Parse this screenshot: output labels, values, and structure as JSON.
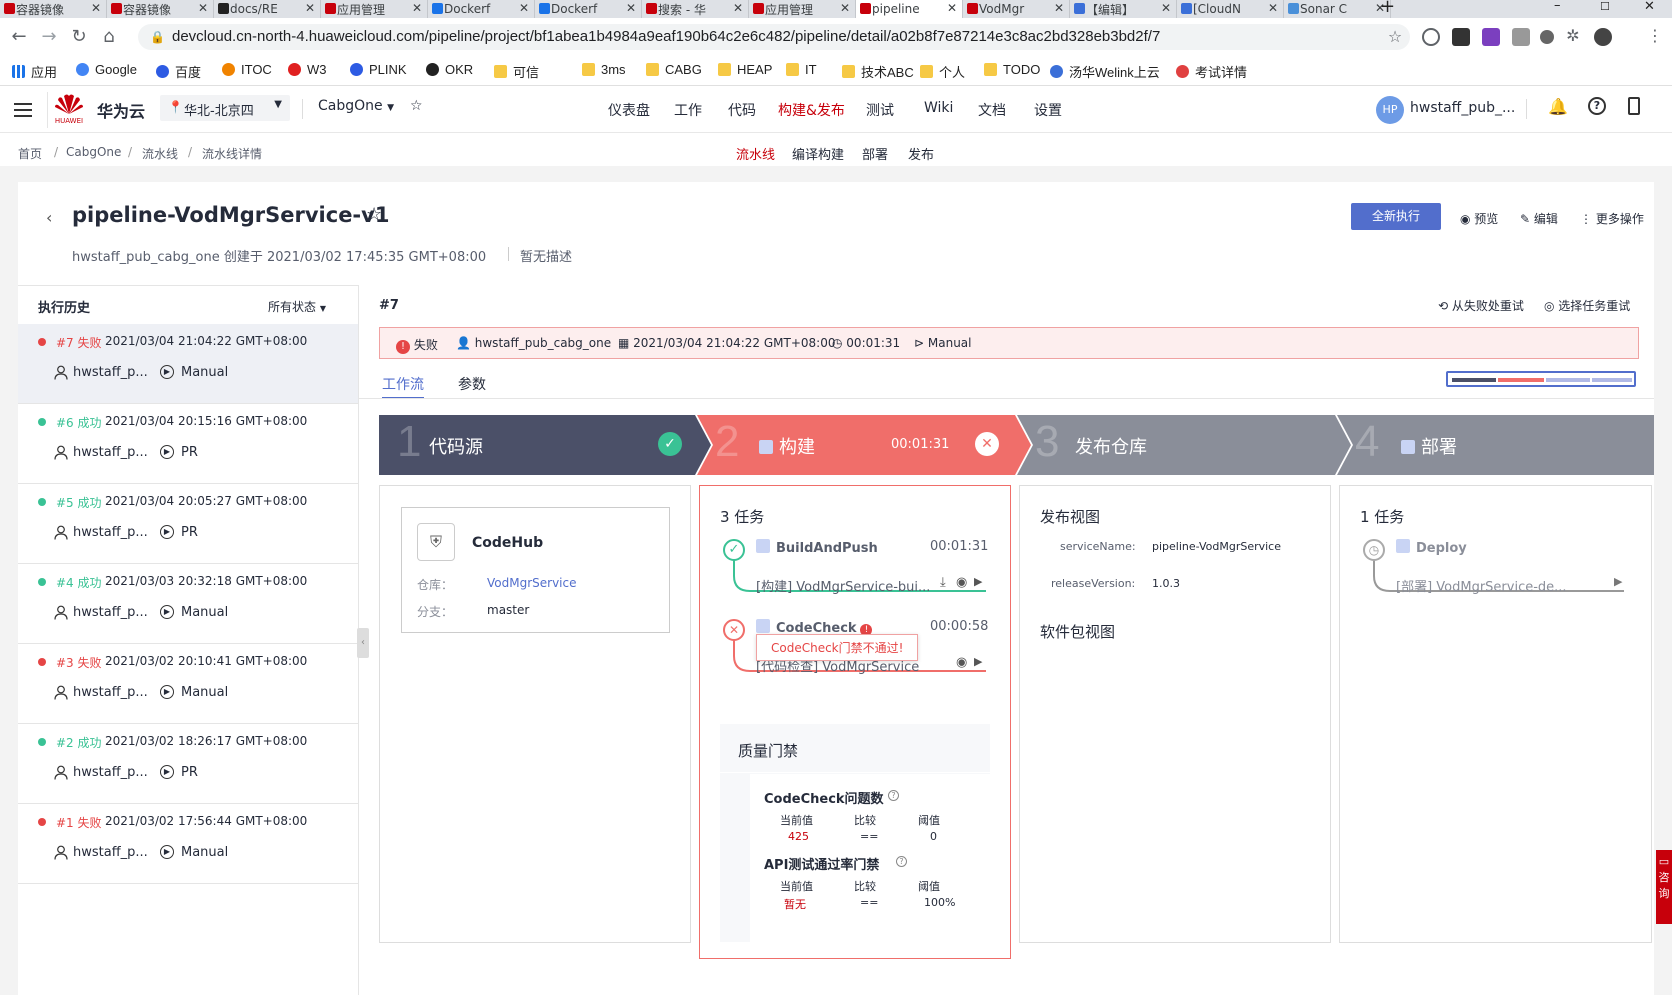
{
  "browser": {
    "tabs": [
      {
        "label": "容器镜像",
        "color": "#c7000b"
      },
      {
        "label": "容器镜像",
        "color": "#c7000b"
      },
      {
        "label": "docs/RE",
        "color": "#222222"
      },
      {
        "label": "应用管理",
        "color": "#c7000b"
      },
      {
        "label": "Dockerf",
        "color": "#1a73e8"
      },
      {
        "label": "Dockerf",
        "color": "#1a73e8"
      },
      {
        "label": "搜索 - 华",
        "color": "#c7000b"
      },
      {
        "label": "应用管理",
        "color": "#c7000b"
      },
      {
        "label": "pipeline",
        "color": "#c7000b"
      },
      {
        "label": "VodMgr",
        "color": "#c7000b"
      },
      {
        "label": "【编辑】",
        "color": "#3b6fd8"
      },
      {
        "label": "[CloudN",
        "color": "#3b6fd8"
      },
      {
        "label": "Sonar C",
        "color": "#4a90d9"
      }
    ],
    "new_tab": "+",
    "win_min": "–",
    "win_max": "☐",
    "url": "devcloud.cn-north-4.huaweicloud.com/pipeline/project/bf1abea1b4984a9eaf190b64c2e6c482/pipeline/detail/a02b8f7e87214e3c8ac2bd328eb3bd2f/7",
    "bookmarks": [
      "应用",
      "Google",
      "百度",
      "ITOC",
      "W3",
      "PLINK",
      "OKR",
      "可信",
      "3ms",
      "CABG",
      "HEAP",
      "IT",
      "技术ABC",
      "个人",
      "TODO",
      "汤华Welink上云",
      "考试详情"
    ]
  },
  "app": {
    "brand": "华为云",
    "logo_text": "HUAWEI",
    "region": "华北-北京四",
    "project": "CabgOne",
    "nav": [
      "仪表盘",
      "工作",
      "代码",
      "构建&发布",
      "测试",
      "Wiki",
      "文档",
      "设置"
    ],
    "active_nav": "构建&发布",
    "user_initials": "HP",
    "user": "hwstaff_pub_...",
    "breadcrumb": [
      "首页",
      "CabgOne",
      "流水线",
      "流水线详情"
    ],
    "bc_sep": "/",
    "subnav": [
      "流水线",
      "编译构建",
      "部署",
      "发布"
    ]
  },
  "pipeline": {
    "name": "pipeline-VodMgrService-v1",
    "meta": "hwstaff_pub_cabg_one 创建于 2021/03/02 17:45:35 GMT+08:00",
    "desc": "暂无描述",
    "run_button": "全新执行",
    "actions": [
      "预览",
      "编辑",
      "更多操作"
    ],
    "history_title": "执行历史",
    "status_filter": "所有状态",
    "history": [
      {
        "num": "#7 失败",
        "time": "2021/03/04 21:04:22 GMT+08:00",
        "user": "hwstaff_p...",
        "trigger": "Manual",
        "status": "fail"
      },
      {
        "num": "#6 成功",
        "time": "2021/03/04 20:15:16 GMT+08:00",
        "user": "hwstaff_p...",
        "trigger": "PR",
        "status": "ok"
      },
      {
        "num": "#5 成功",
        "time": "2021/03/04 20:05:27 GMT+08:00",
        "user": "hwstaff_p...",
        "trigger": "PR",
        "status": "ok"
      },
      {
        "num": "#4 成功",
        "time": "2021/03/03 20:32:18 GMT+08:00",
        "user": "hwstaff_p...",
        "trigger": "Manual",
        "status": "ok"
      },
      {
        "num": "#3 失败",
        "time": "2021/03/02 20:10:41 GMT+08:00",
        "user": "hwstaff_p...",
        "trigger": "Manual",
        "status": "fail"
      },
      {
        "num": "#2 成功",
        "time": "2021/03/02 18:26:17 GMT+08:00",
        "user": "hwstaff_p...",
        "trigger": "PR",
        "status": "ok"
      },
      {
        "num": "#1 失败",
        "time": "2021/03/02 17:56:44 GMT+08:00",
        "user": "hwstaff_p...",
        "trigger": "Manual",
        "status": "fail"
      }
    ],
    "run": {
      "id": "#7",
      "retry_failed": "从失败处重试",
      "select_retry": "选择任务重试",
      "status": "失败",
      "user": "hwstaff_pub_cabg_one",
      "time": "2021/03/04 21:04:22 GMT+08:00",
      "duration": "00:01:31",
      "trigger": "Manual",
      "tabs": [
        "工作流",
        "参数"
      ]
    },
    "stages": [
      {
        "num": "1",
        "name": "代码源",
        "color": "#4b5068"
      },
      {
        "num": "2",
        "name": "构建",
        "color": "#f06e6a",
        "duration": "00:01:31"
      },
      {
        "num": "3",
        "name": "发布仓库",
        "color": "#8a8e99"
      },
      {
        "num": "4",
        "name": "部署",
        "color": "#8a8e99"
      }
    ],
    "source": {
      "name": "CodeHub",
      "repo_label": "仓库：",
      "repo": "VodMgrService",
      "branch_label": "分支：",
      "branch": "master"
    },
    "build": {
      "task_count": "3 任务",
      "tasks": [
        {
          "name": "BuildAndPush",
          "time": "00:01:31",
          "sub": "[构建] VodMgrService-bui..."
        },
        {
          "name": "CodeCheck",
          "time": "00:00:58",
          "sub": "[代码检查] VodMgrService",
          "tooltip": "CodeCheck门禁不通过!"
        }
      ],
      "gate_title": "质量门禁",
      "gates": [
        {
          "name": "CodeCheck问题数",
          "cols": [
            "当前值",
            "比较",
            "阈值"
          ],
          "current": "425",
          "cmp": "==",
          "threshold": "0"
        },
        {
          "name": "API测试通过率门禁",
          "cols": [
            "当前值",
            "比较",
            "阈值"
          ],
          "current": "暂无",
          "cmp": "==",
          "threshold": "100%"
        }
      ]
    },
    "release": {
      "title": "发布视图",
      "service_label": "serviceName:",
      "service": "pipeline-VodMgrService",
      "version_label": "releaseVersion:",
      "version": "1.0.3",
      "pkg_title": "软件包视图"
    },
    "deploy": {
      "task_count": "1 任务",
      "task": "Deploy",
      "sub": "[部署] VodMgrService-de..."
    },
    "consult": "咨询"
  }
}
